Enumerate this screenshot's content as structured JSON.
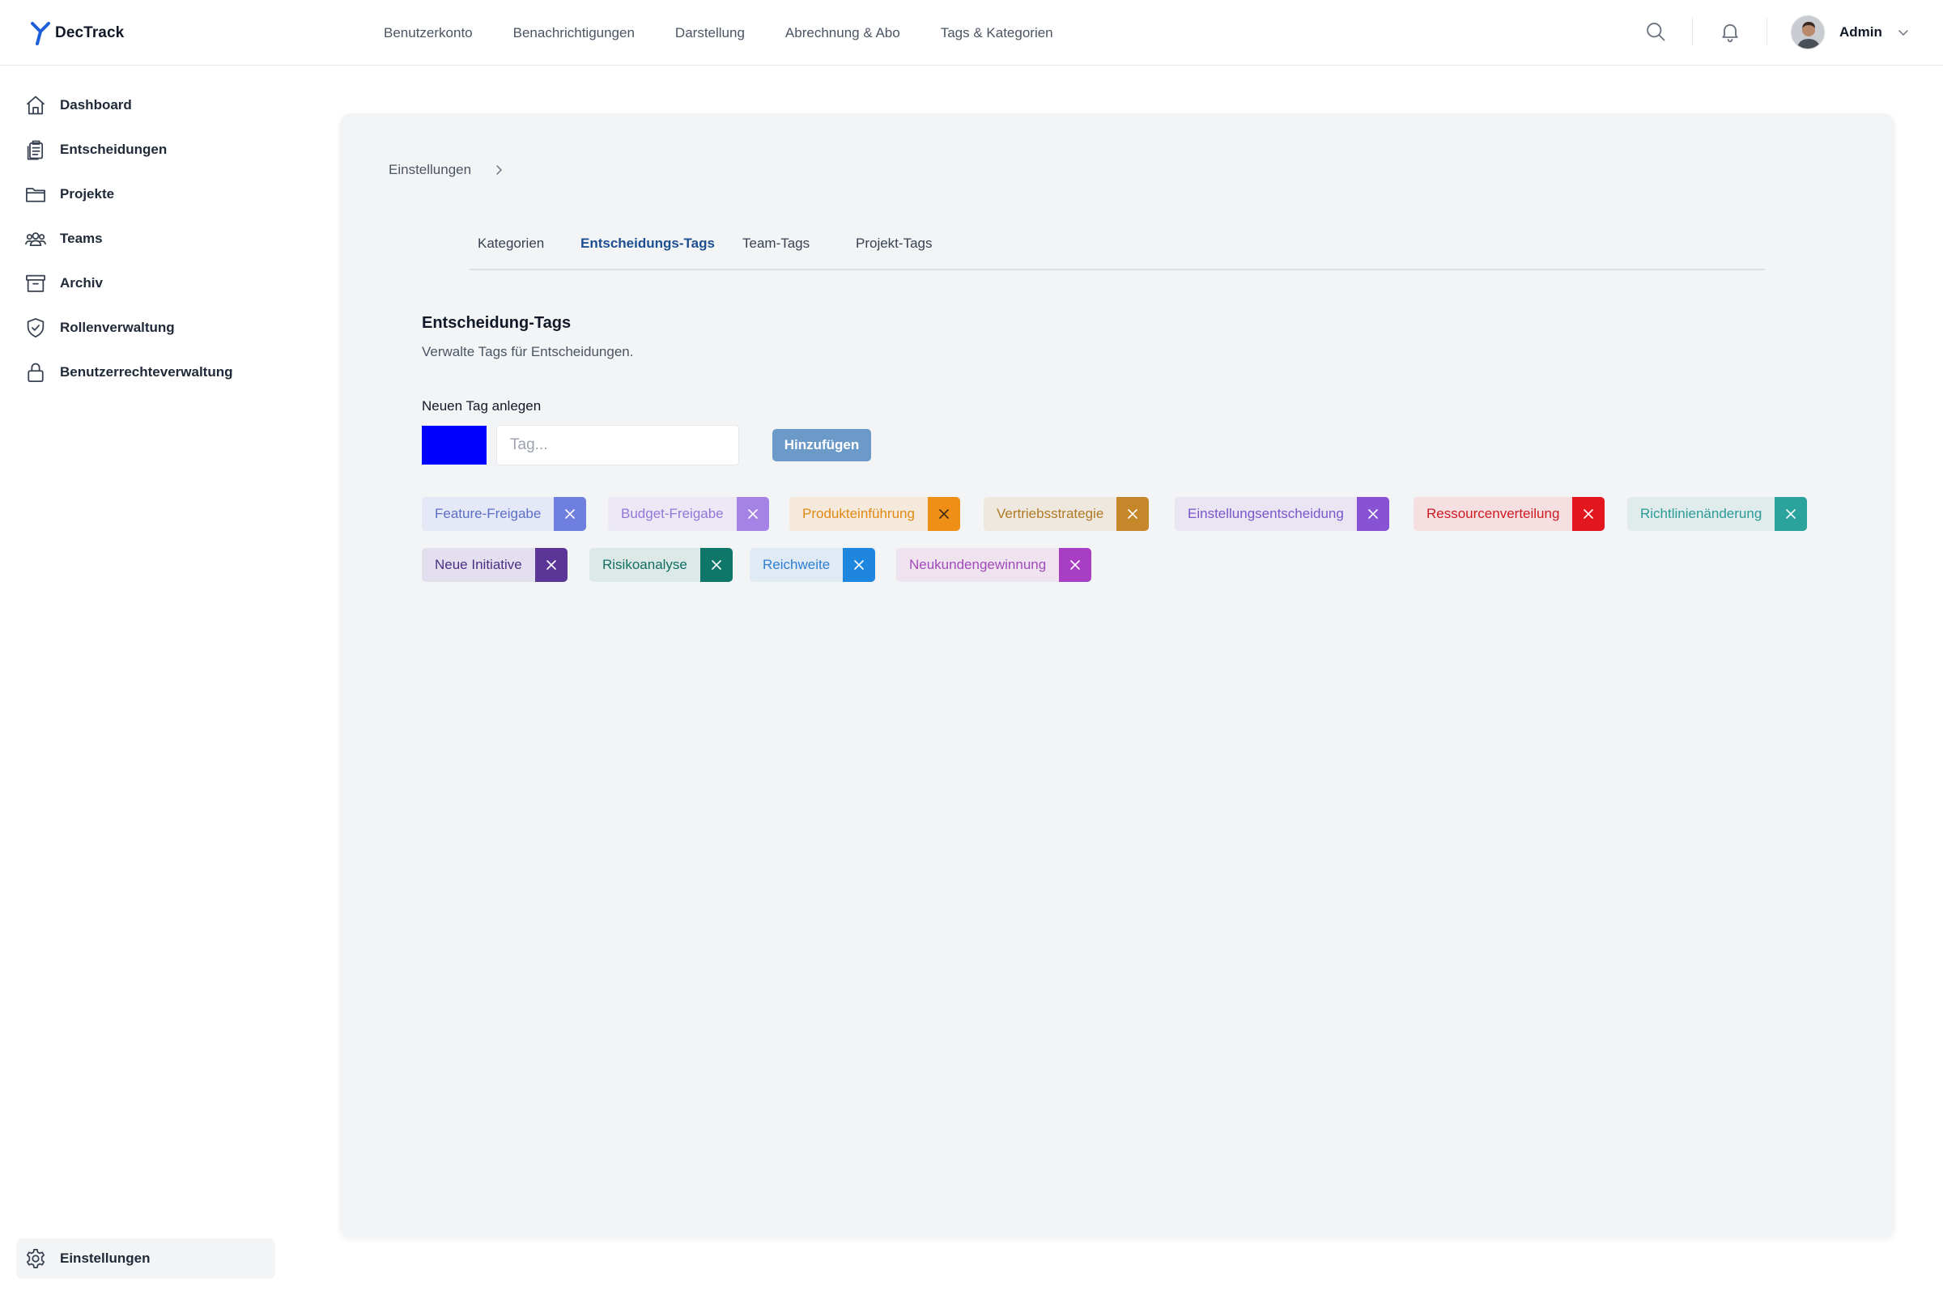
{
  "app": {
    "name": "DecTrack"
  },
  "header": {
    "nav": [
      "Benutzerkonto",
      "Benachrichtigungen",
      "Darstellung",
      "Abrechnung & Abo",
      "Tags & Kategorien"
    ],
    "user_name": "Admin"
  },
  "sidebar": {
    "items": [
      {
        "label": "Dashboard",
        "icon": "home-icon"
      },
      {
        "label": "Entscheidungen",
        "icon": "clipboard-icon"
      },
      {
        "label": "Projekte",
        "icon": "folder-icon"
      },
      {
        "label": "Teams",
        "icon": "users-icon"
      },
      {
        "label": "Archiv",
        "icon": "archive-icon"
      },
      {
        "label": "Rollenverwaltung",
        "icon": "shield-check-icon"
      },
      {
        "label": "Benutzerrechteverwaltung",
        "icon": "lock-icon"
      }
    ],
    "settings_label": "Einstellungen"
  },
  "breadcrumb": {
    "root": "Einstellungen"
  },
  "tabs": [
    {
      "label": "Kategorien",
      "active": false
    },
    {
      "label": "Entscheidungs-Tags",
      "active": true
    },
    {
      "label": "Team-Tags",
      "active": false
    },
    {
      "label": "Projekt-Tags",
      "active": false
    }
  ],
  "section": {
    "title": "Entscheidung-Tags",
    "description": "Verwalte Tags für Entscheidungen.",
    "new_label": "Neuen Tag anlegen",
    "color_value": "#0000ff",
    "input_placeholder": "Tag...",
    "input_value": "",
    "add_button": "Hinzufügen"
  },
  "tags": [
    {
      "label": "Feature-Freigabe",
      "bg": "#e5e8f6",
      "text": "#5b6fc7",
      "accent": "#6e7fe0"
    },
    {
      "label": "Budget-Freigabe",
      "bg": "#ece8f6",
      "text": "#9277d6",
      "accent": "#a583e6"
    },
    {
      "label": "Produkteinführung",
      "bg": "#f5e9dc",
      "text": "#e08913",
      "accent": "#f08f17"
    },
    {
      "label": "Vertriebsstrategie",
      "bg": "#efe8df",
      "text": "#b07a25",
      "accent": "#c5872a"
    },
    {
      "label": "Einstellungsentscheidung",
      "bg": "#e9e5f3",
      "text": "#7a56c9",
      "accent": "#8752d4"
    },
    {
      "label": "Ressourcenverteilung",
      "bg": "#f6dfe1",
      "text": "#cc1b23",
      "accent": "#e3151e"
    },
    {
      "label": "Richtlinienänderung",
      "bg": "#e0ecec",
      "text": "#2b9b97",
      "accent": "#2ba39d"
    },
    {
      "label": "Neue Initiative",
      "bg": "#e3dfee",
      "text": "#4a2f83",
      "accent": "#5c3697"
    },
    {
      "label": "Risikoanalyse",
      "bg": "#dde9e7",
      "text": "#126d63",
      "accent": "#0f776a"
    },
    {
      "label": "Reichweite",
      "bg": "#e0eaf5",
      "text": "#2e7fd1",
      "accent": "#1f86e0"
    },
    {
      "label": "Neukundengewinnung",
      "bg": "#efe3f0",
      "text": "#a14aba",
      "accent": "#a73ec4"
    }
  ]
}
